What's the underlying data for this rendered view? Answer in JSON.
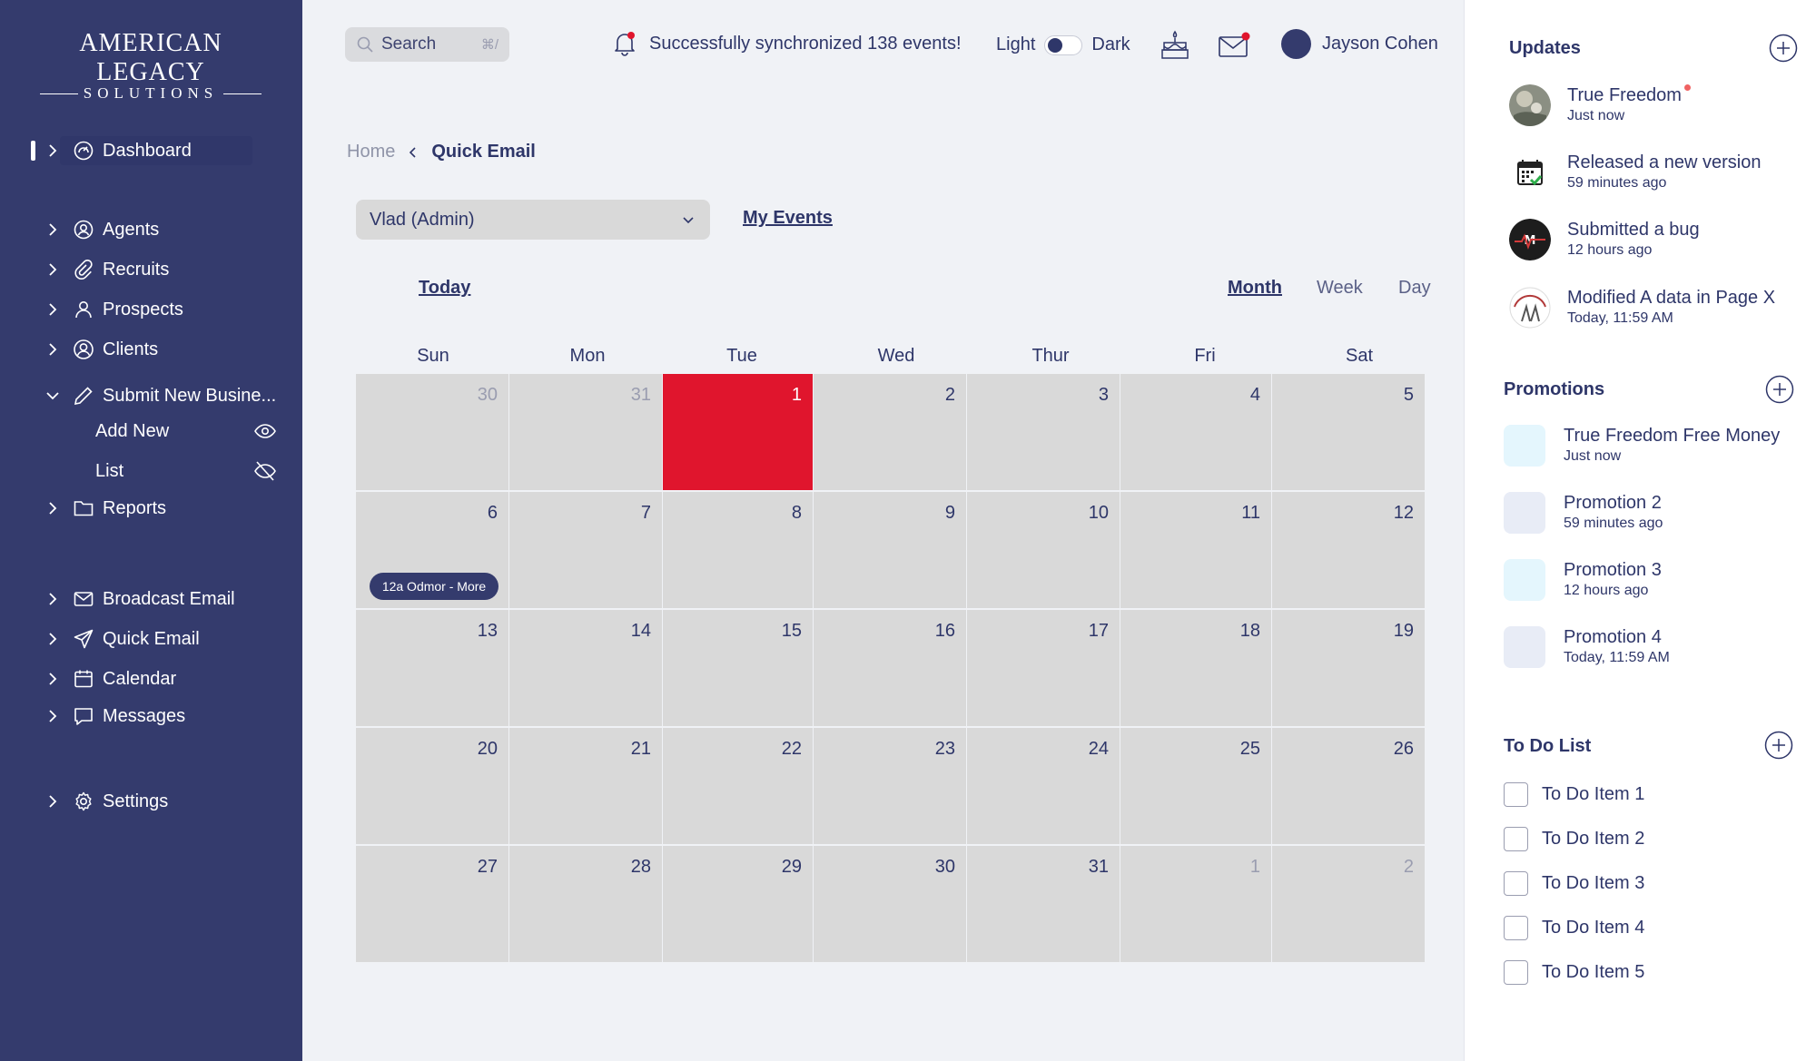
{
  "brand": {
    "line1": "AMERICAN LEGACY",
    "line2": "SOLUTIONS"
  },
  "sidebar": {
    "items": [
      {
        "label": "Dashboard",
        "icon": "dashboard-gauge-icon"
      },
      {
        "label": "Agents",
        "icon": "agents-icon"
      },
      {
        "label": "Recruits",
        "icon": "paperclip-icon"
      },
      {
        "label": "Prospects",
        "icon": "user-icon"
      },
      {
        "label": "Clients",
        "icon": "clients-icon"
      },
      {
        "label": "Submit New Busine...",
        "icon": "pencil-icon"
      },
      {
        "label": "Reports",
        "icon": "folder-icon"
      },
      {
        "label": "Broadcast Email",
        "icon": "envelope-icon"
      },
      {
        "label": "Quick Email",
        "icon": "send-icon"
      },
      {
        "label": "Calendar",
        "icon": "calendar-icon"
      },
      {
        "label": "Messages",
        "icon": "chat-icon"
      },
      {
        "label": "Settings",
        "icon": "gear-icon"
      }
    ],
    "subitems": [
      {
        "label": "Add New",
        "icon": "eye-icon"
      },
      {
        "label": "List",
        "icon": "eye-off-icon"
      }
    ]
  },
  "topbar": {
    "search_placeholder": "Search",
    "search_shortcut": "⌘/",
    "notification": "Successfully synchronized 138 events!",
    "theme_light": "Light",
    "theme_dark": "Dark",
    "user_name": "Jayson Cohen"
  },
  "breadcrumb": {
    "home": "Home",
    "current": "Quick Email"
  },
  "filter": {
    "selected": "Vlad (Admin)",
    "my_events": "My Events"
  },
  "calendar": {
    "today_label": "Today",
    "views": [
      "Month",
      "Week",
      "Day"
    ],
    "active_view": "Month",
    "weekdays": [
      "Sun",
      "Mon",
      "Tue",
      "Wed",
      "Thur",
      "Fri",
      "Sat"
    ],
    "weeks": [
      [
        "30",
        "31",
        "1",
        "2",
        "3",
        "4",
        "5"
      ],
      [
        "6",
        "7",
        "8",
        "9",
        "10",
        "11",
        "12"
      ],
      [
        "13",
        "14",
        "15",
        "16",
        "17",
        "18",
        "19"
      ],
      [
        "20",
        "21",
        "22",
        "23",
        "24",
        "25",
        "26"
      ],
      [
        "27",
        "28",
        "29",
        "30",
        "31",
        "1",
        "2"
      ]
    ],
    "event": "12a Odmor - More",
    "colors": {
      "today": "#e0152d",
      "cell": "#d9d9d9",
      "event": "#343b6d"
    }
  },
  "updates": {
    "title": "Updates",
    "items": [
      {
        "title": "True Freedom",
        "time": "Just now"
      },
      {
        "title": "Released a new version",
        "time": "59 minutes ago"
      },
      {
        "title": "Submitted a bug",
        "time": "12 hours ago"
      },
      {
        "title": "Modified A data in Page X",
        "time": "Today, 11:59 AM"
      }
    ]
  },
  "promotions": {
    "title": "Promotions",
    "items": [
      {
        "title": "True Freedom Free Money",
        "time": "Just now"
      },
      {
        "title": "Promotion 2",
        "time": "59 minutes ago"
      },
      {
        "title": "Promotion 3",
        "time": "12 hours ago"
      },
      {
        "title": "Promotion 4",
        "time": "Today, 11:59 AM"
      }
    ]
  },
  "todo": {
    "title": "To Do List",
    "items": [
      "To Do Item 1",
      "To Do Item 2",
      "To Do Item 3",
      "To Do Item 4",
      "To Do Item 5"
    ]
  },
  "colors": {
    "sidebar": "#343b6d",
    "accent": "#2e3669",
    "notify_dot": "#e0152d"
  }
}
